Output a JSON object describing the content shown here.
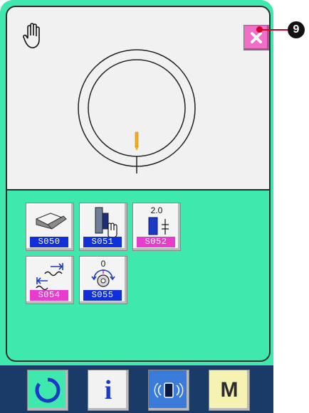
{
  "screen": {
    "close_icon": "close-icon",
    "callout_number": "9",
    "callout_color": "#d0002a",
    "accent_color": "#3fe8ad"
  },
  "buttons": [
    {
      "code": "S050",
      "code_color": "blue",
      "icon": "presser-foot-icon"
    },
    {
      "code": "S051",
      "code_color": "blue",
      "icon": "thread-clamp-hand-icon"
    },
    {
      "code": "S052",
      "code_color": "pink",
      "value": "2.0",
      "icon": "stitch-length-icon"
    },
    {
      "code": "S054",
      "code_color": "pink",
      "icon": "stitch-shift-icon"
    },
    {
      "code": "S055",
      "code_color": "blue",
      "value": "0",
      "icon": "rotation-origin-icon"
    }
  ],
  "nav": {
    "reset_icon": "reset-icon",
    "info_label": "i",
    "comm_icon": "communication-icon",
    "mode_label": "M"
  }
}
